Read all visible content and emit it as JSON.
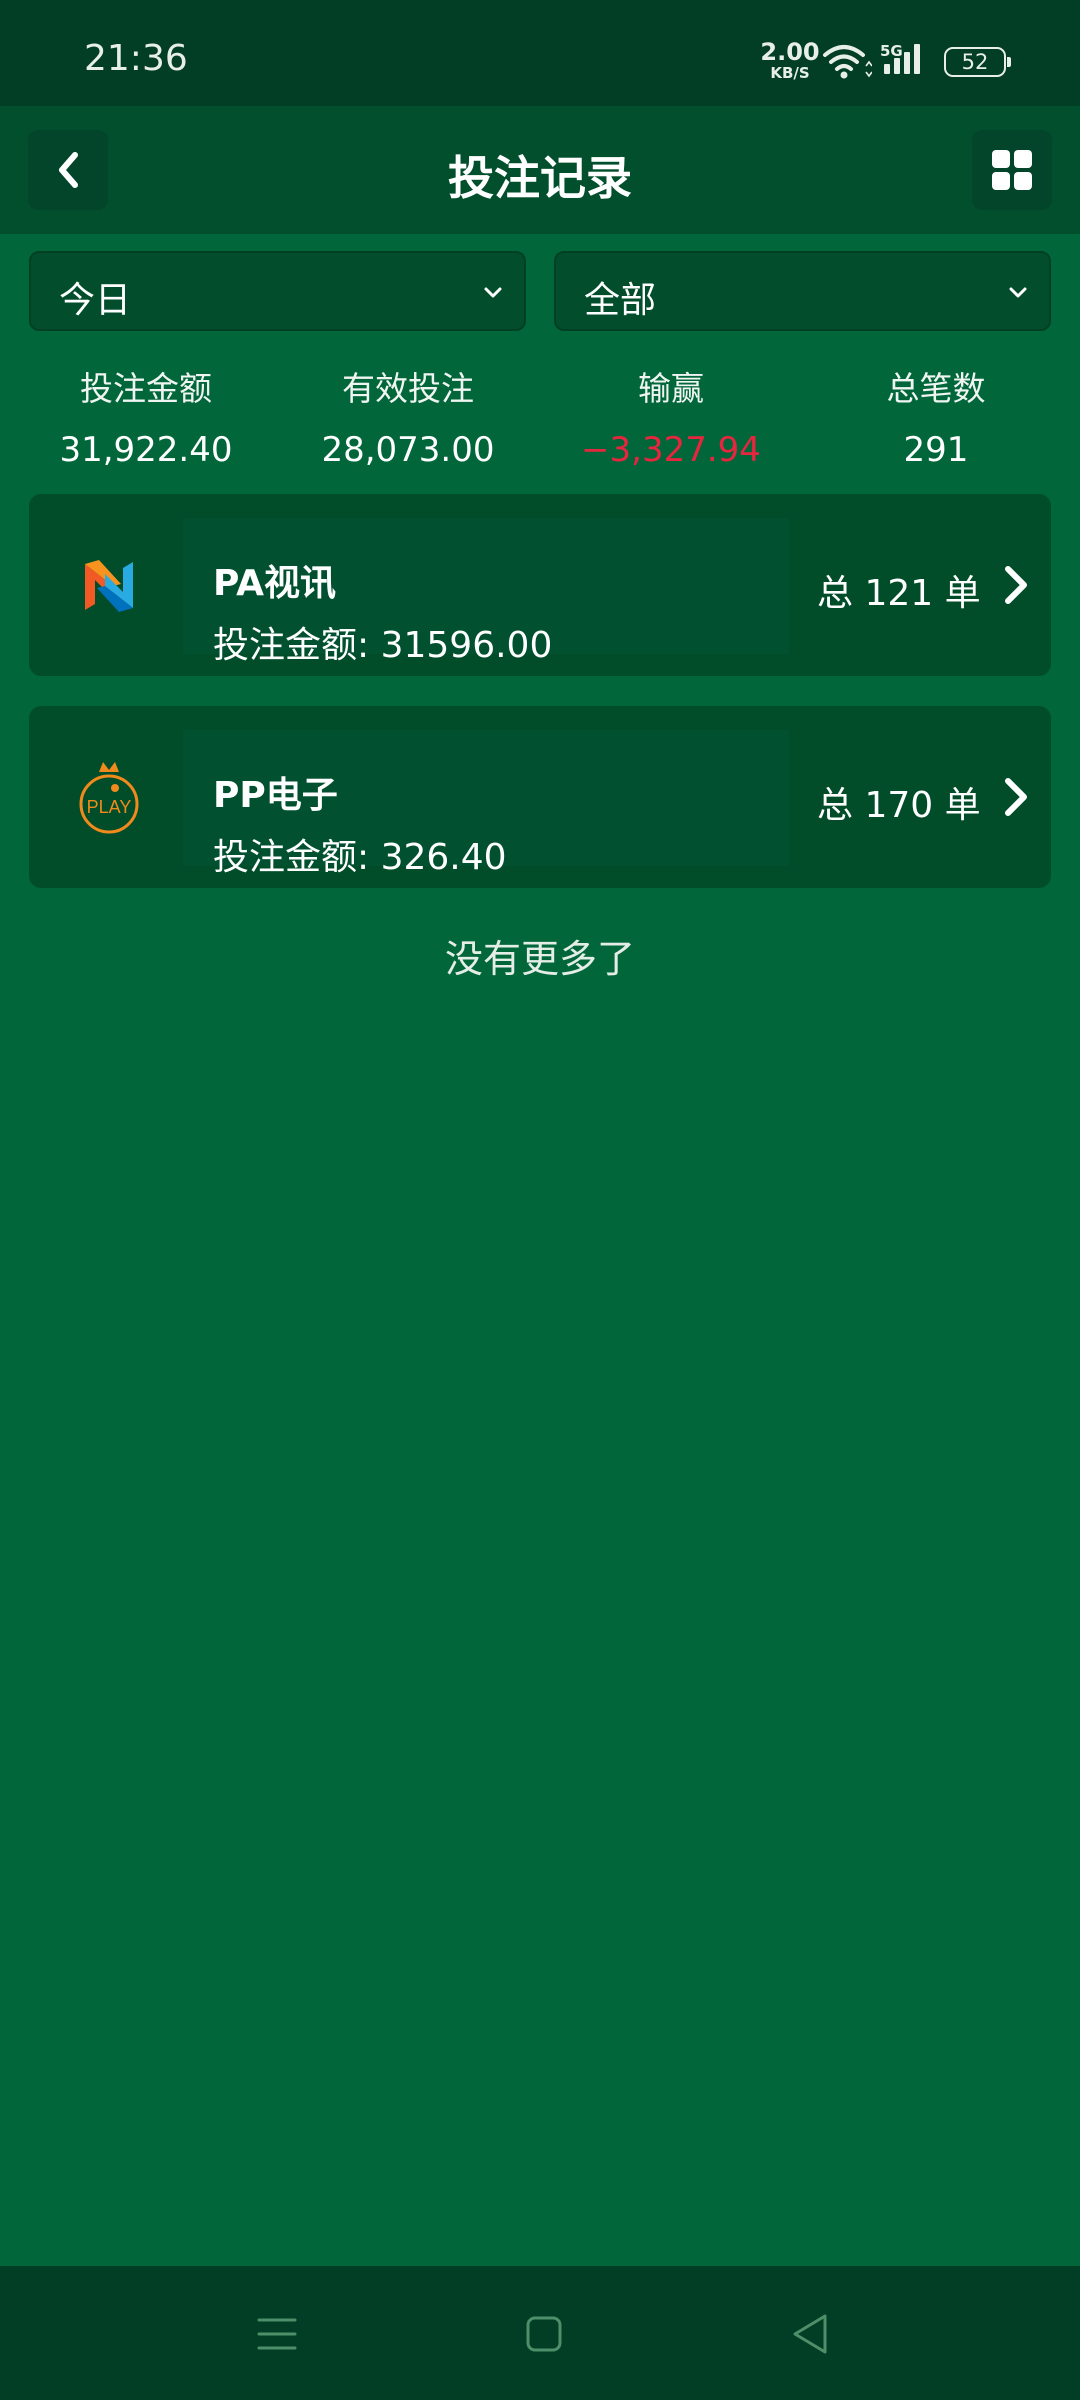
{
  "status_bar": {
    "time": "21:36",
    "net_speed_value": "2.00",
    "net_speed_unit": "KB/S",
    "network_type": "5G",
    "battery": "52"
  },
  "header": {
    "title": "投注记录",
    "back_icon": "chevron-left-icon",
    "menu_icon": "grid-icon"
  },
  "filters": {
    "date": "今日",
    "type": "全部"
  },
  "summary": [
    {
      "label": "投注金额",
      "value": "31,922.40"
    },
    {
      "label": "有效投注",
      "value": "28,073.00"
    },
    {
      "label": "输赢",
      "value": "−3,327.94"
    },
    {
      "label": "总笔数",
      "value": "291"
    }
  ],
  "records": [
    {
      "name": "PA视讯",
      "amount": "投注金额: 31596.00",
      "count": "总 121 单",
      "logo": "pa-logo-icon"
    },
    {
      "name": "PP电子",
      "amount": "投注金额: 326.40",
      "count": "总 170 单",
      "logo": "pp-play-logo-icon",
      "logo_text": "PLAY"
    }
  ],
  "footer_text": "没有更多了",
  "colors": {
    "background": "#01673b",
    "header": "#024f2d",
    "negative": "#e8253f",
    "accent_orange": "#f08a1c"
  }
}
